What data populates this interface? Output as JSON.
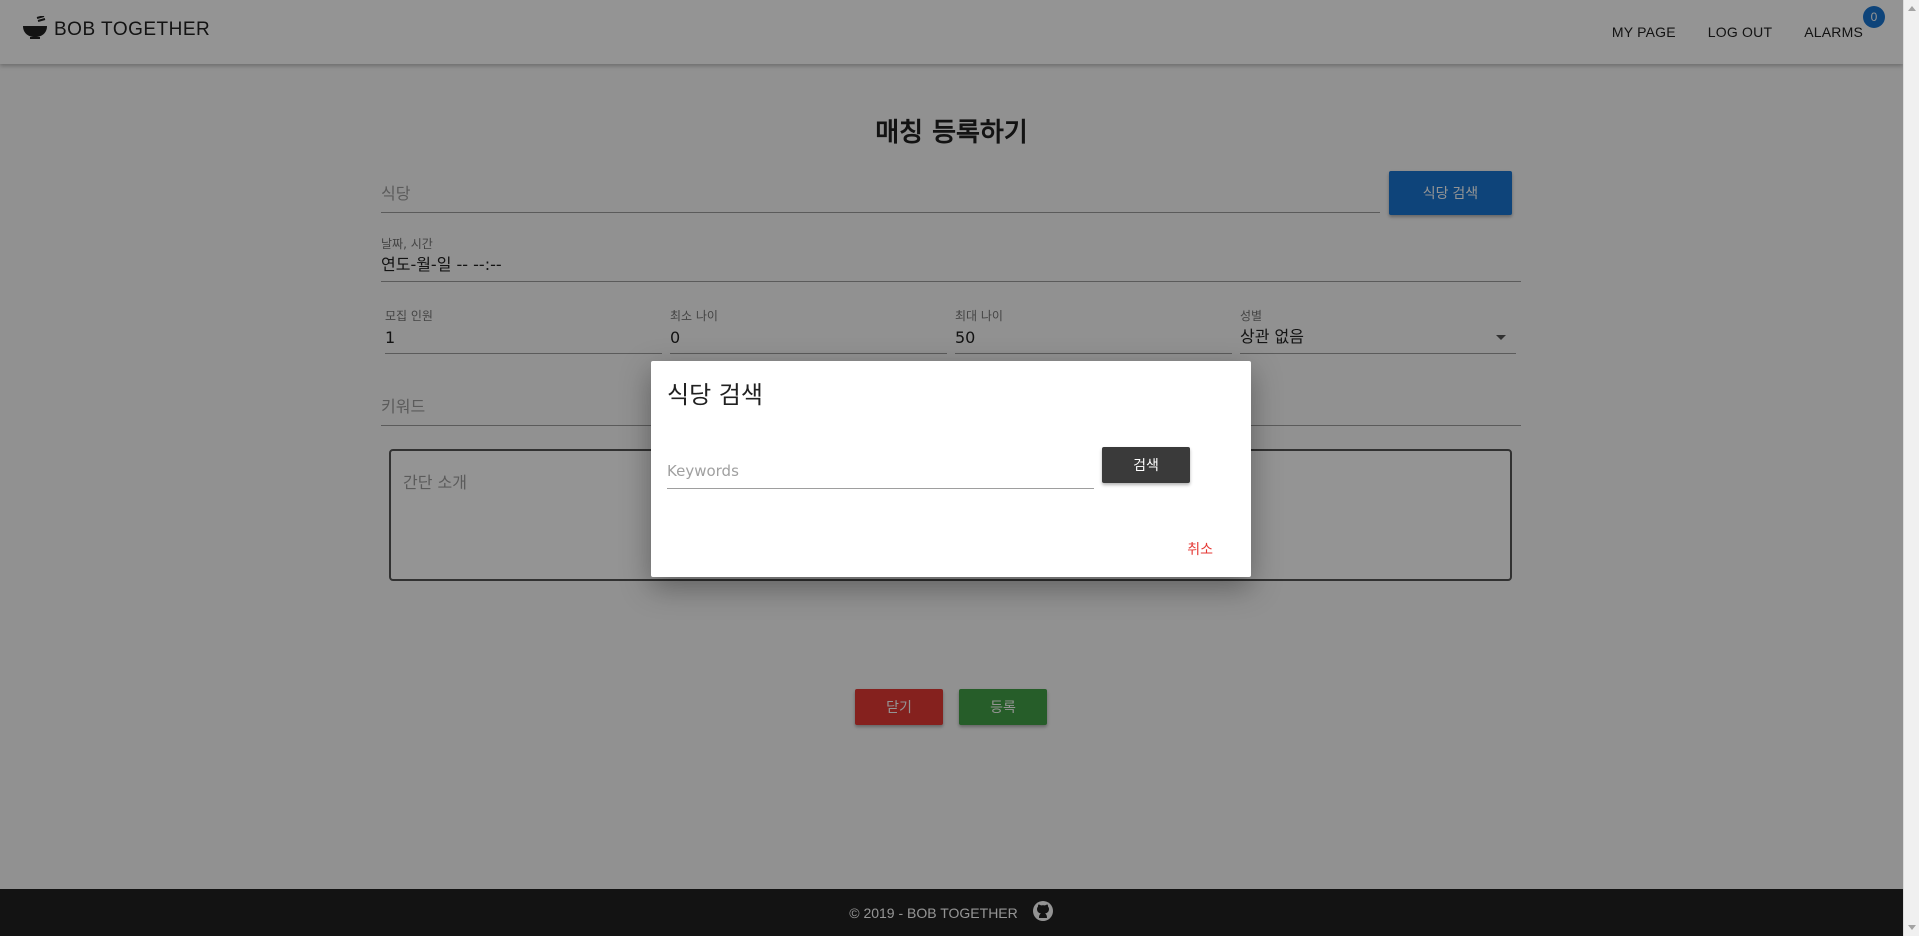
{
  "header": {
    "brand": "BOB TOGETHER",
    "nav": {
      "my_page": "MY PAGE",
      "logout": "LOG OUT",
      "alarms": "ALARMS",
      "alarm_count": "0"
    }
  },
  "form": {
    "title": "매칭 등록하기",
    "restaurant_placeholder": "식당",
    "restaurant_search_button": "식당 검색",
    "datetime": {
      "label": "날짜, 시간",
      "value": "연도-월-일 -- --:--"
    },
    "recruit": {
      "label": "모집 인원",
      "value": "1"
    },
    "min_age": {
      "label": "최소 나이",
      "value": "0"
    },
    "max_age": {
      "label": "최대 나이",
      "value": "50"
    },
    "gender": {
      "label": "성별",
      "value": "상관 없음"
    },
    "keyword_placeholder": "키워드",
    "intro_placeholder": "간단 소개",
    "close_button": "닫기",
    "submit_button": "등록"
  },
  "dialog": {
    "title": "식당 검색",
    "input_placeholder": "Keywords",
    "search_button": "검색",
    "cancel_button": "취소"
  },
  "footer": {
    "text": "© 2019 - BOB TOGETHER"
  },
  "colors": {
    "primary": "#1976d2",
    "danger": "#e53935",
    "success": "#43a047",
    "dark": "#212121"
  },
  "icons": {
    "brand": "rice-bowl-icon",
    "footer": "github-icon"
  }
}
